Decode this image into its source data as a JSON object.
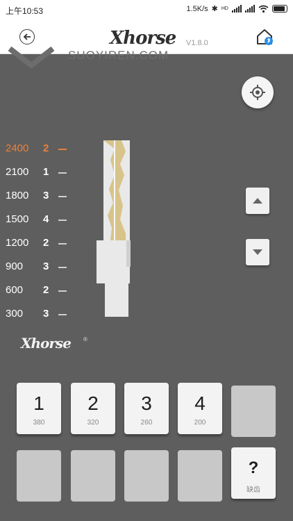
{
  "status": {
    "time": "上午10:53",
    "speed": "1.5K/s",
    "hd": "HD"
  },
  "header": {
    "brand": "Xhorse",
    "version": "V1.8.0"
  },
  "workspace": {
    "watermark": "SUOYIREN.COM"
  },
  "depths": [
    {
      "depth": "2400",
      "cut": "2",
      "active": true
    },
    {
      "depth": "2100",
      "cut": "1",
      "active": false
    },
    {
      "depth": "1800",
      "cut": "3",
      "active": false
    },
    {
      "depth": "1500",
      "cut": "4",
      "active": false
    },
    {
      "depth": "1200",
      "cut": "2",
      "active": false
    },
    {
      "depth": "900",
      "cut": "3",
      "active": false
    },
    {
      "depth": "600",
      "cut": "2",
      "active": false
    },
    {
      "depth": "300",
      "cut": "3",
      "active": false
    }
  ],
  "logo": {
    "text": "Xhorse",
    "reg": "®"
  },
  "keypad": {
    "keys": [
      {
        "label": "1",
        "sub": "380"
      },
      {
        "label": "2",
        "sub": "320"
      },
      {
        "label": "3",
        "sub": "260"
      },
      {
        "label": "4",
        "sub": "200"
      }
    ],
    "missing": {
      "label": "?",
      "sub": "缺齿"
    }
  },
  "colors": {
    "background": "#5e5e5e",
    "accent": "#e8823a",
    "blade": "#d8c48a",
    "key_face": "#f3f3f3"
  },
  "icons": [
    "back-icon",
    "home-bluetooth-icon",
    "locate-icon",
    "arrow-up-icon",
    "arrow-down-icon",
    "wifi-icon",
    "signal-icon",
    "battery-icon",
    "bluetooth-icon"
  ]
}
